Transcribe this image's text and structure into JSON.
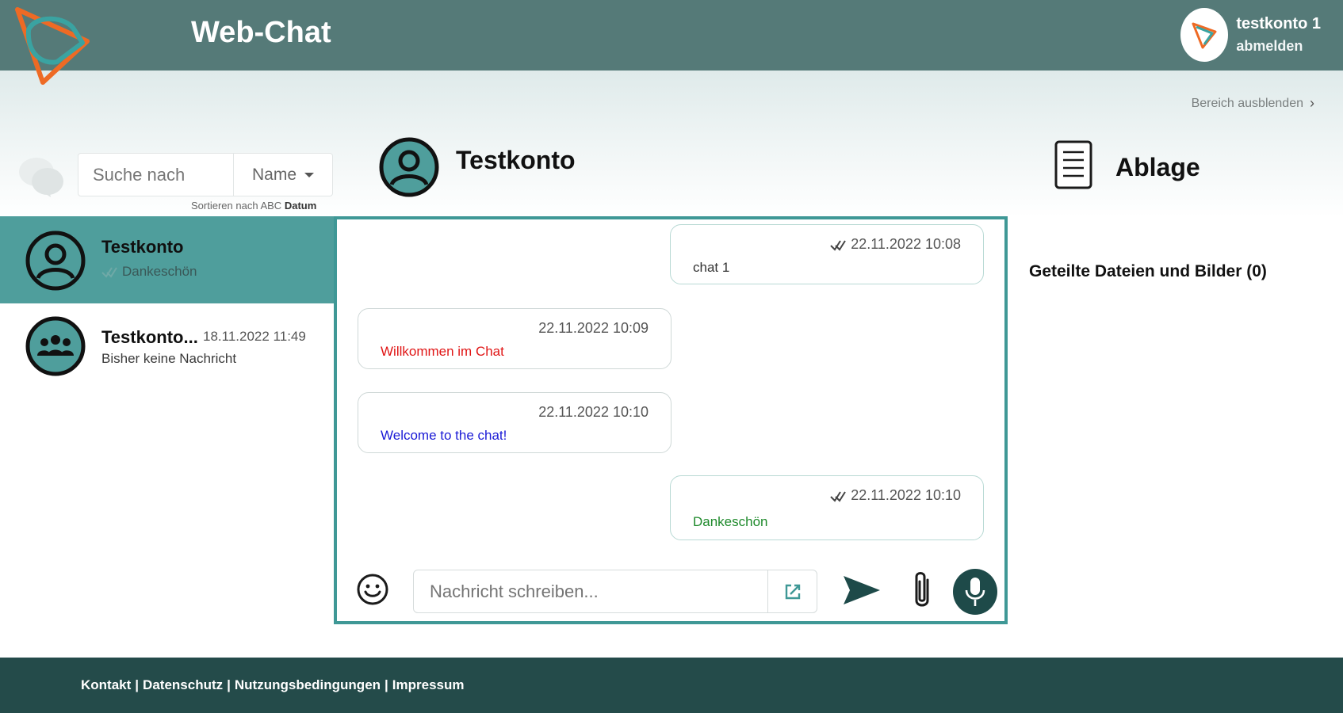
{
  "header": {
    "app_title": "Web-Chat",
    "user_name": "testkonto 1",
    "logout_label": "abmelden"
  },
  "toolbar": {
    "hide_area_label": "Bereich ausblenden"
  },
  "sidebar": {
    "search_placeholder": "Suche nach",
    "sort_field": "Name",
    "sort_hint_prefix": "Sortieren nach",
    "sort_abc": "ABC",
    "sort_date": "Datum",
    "contacts": [
      {
        "name": "Testkonto",
        "date": "",
        "last_message": "Dankeschön",
        "active": true,
        "type": "person"
      },
      {
        "name": "Testkonto...",
        "date": "18.11.2022 11:49",
        "last_message": "Bisher keine Nachricht",
        "active": false,
        "type": "group"
      }
    ]
  },
  "chat": {
    "contact_name": "Testkonto",
    "messages": [
      {
        "direction": "out",
        "time": "22.11.2022 10:08",
        "text": "chat 1",
        "color": "#333333",
        "read": true
      },
      {
        "direction": "in",
        "time": "22.11.2022 10:09",
        "text": "Willkommen im Chat",
        "color": "#e01515",
        "read": false
      },
      {
        "direction": "in",
        "time": "22.11.2022 10:10",
        "text": "Welcome to the chat!",
        "color": "#1a1ad6",
        "read": false
      },
      {
        "direction": "out",
        "time": "22.11.2022 10:10",
        "text": "Dankeschön",
        "color": "#1f8a2c",
        "read": true
      }
    ],
    "composer_placeholder": "Nachricht schreiben..."
  },
  "storage": {
    "title": "Ablage",
    "shared_files_label": "Geteilte Dateien und Bilder (0)"
  },
  "footer": {
    "links": [
      "Kontakt",
      "Datenschutz",
      "Nutzungsbedingungen",
      "Impressum"
    ]
  },
  "colors": {
    "header_bg": "#557a78",
    "accent": "#4f9e9c",
    "panel_border": "#3f9896",
    "footer_bg": "#244b4a",
    "logo_orange": "#ee6a24",
    "logo_teal": "#3aa3a1"
  }
}
